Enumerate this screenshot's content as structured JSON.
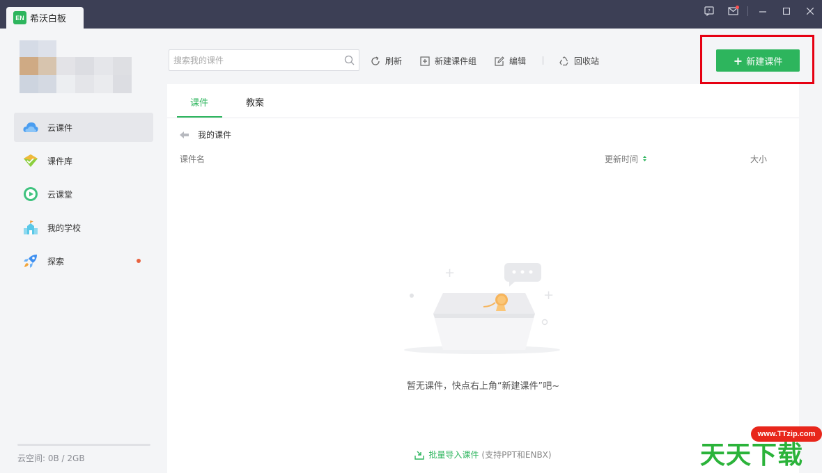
{
  "window": {
    "app_title": "希沃白板",
    "logo_text": "EN"
  },
  "sidebar": {
    "items": [
      {
        "label": "云课件",
        "icon": "cloud-icon",
        "active": true
      },
      {
        "label": "课件库",
        "icon": "library-icon",
        "active": false
      },
      {
        "label": "云课堂",
        "icon": "play-circle-icon",
        "active": false
      },
      {
        "label": "我的学校",
        "icon": "school-icon",
        "active": false
      },
      {
        "label": "探索",
        "icon": "rocket-icon",
        "active": false,
        "badge_dot": true
      }
    ],
    "storage_text": "云空间:   0B / 2GB",
    "storage_used_fraction": 0
  },
  "toolbar": {
    "search_placeholder": "搜索我的课件",
    "refresh_label": "刷新",
    "new_group_label": "新建课件组",
    "edit_label": "编辑",
    "recycle_label": "回收站",
    "new_courseware_label": "新建课件"
  },
  "main": {
    "tabs": [
      {
        "label": "课件",
        "active": true
      },
      {
        "label": "教案",
        "active": false
      }
    ],
    "breadcrumb": "我的课件",
    "columns": {
      "name": "课件名",
      "updated": "更新时间",
      "size": "大小"
    },
    "empty_text": "暂无课件，快点右上角“新建课件”吧~",
    "import_link": "批量导入课件",
    "import_note": "(支持PPT和ENBX)"
  },
  "watermark": {
    "url": "www.TTzip.com",
    "text": "天天下载"
  },
  "colors": {
    "accent": "#2db55d",
    "titlebar": "#3c3f55",
    "highlight": "#e60012"
  }
}
